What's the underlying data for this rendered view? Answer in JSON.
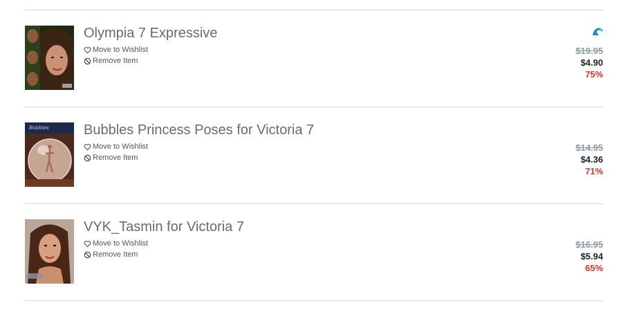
{
  "cart": {
    "items": [
      {
        "title": "Olympia 7 Expressive",
        "wishlist_label": "Move to Wishlist",
        "remove_label": "Remove Item",
        "original_price": "$19.95",
        "sale_price": "$4.90",
        "discount": "75%",
        "badge_icon": "dolphin-icon",
        "badge_color": "#1d8fc4"
      },
      {
        "title": "Bubbles Princess Poses for Victoria 7",
        "wishlist_label": "Move to Wishlist",
        "remove_label": "Remove Item",
        "original_price": "$14.95",
        "sale_price": "$4.36",
        "discount": "71%"
      },
      {
        "title": "VYK_Tasmin for Victoria 7",
        "wishlist_label": "Move to Wishlist",
        "remove_label": "Remove Item",
        "original_price": "$16.95",
        "sale_price": "$5.94",
        "discount": "65%"
      }
    ]
  },
  "colors": {
    "title": "#6a6a6a",
    "original_price": "#8a9aa6",
    "sale_price": "#222222",
    "discount": "#e4312b",
    "divider": "#d6d6d6"
  }
}
